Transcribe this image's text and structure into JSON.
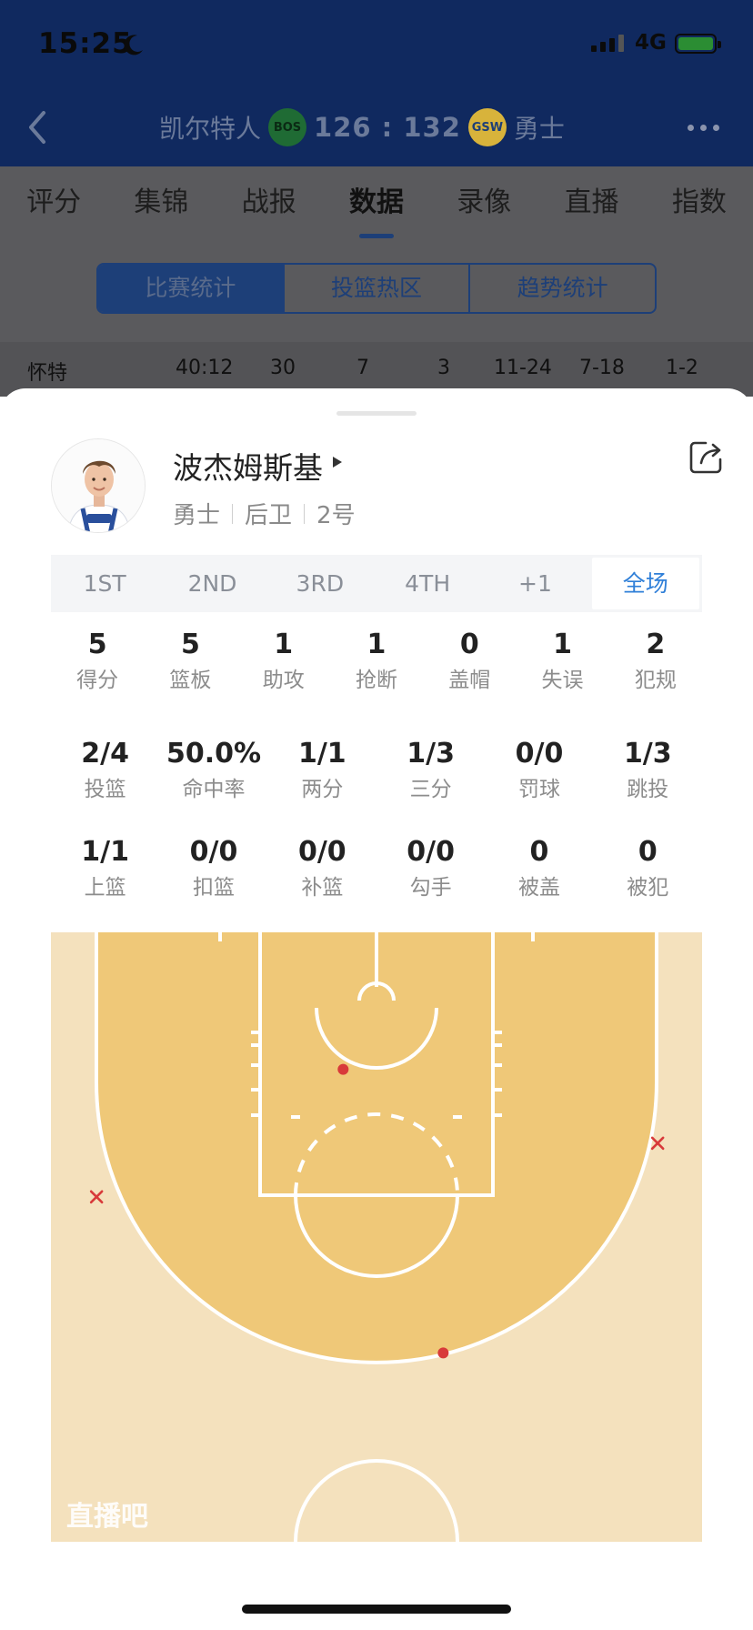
{
  "status_bar": {
    "time": "15:25",
    "network": "4G"
  },
  "header": {
    "home_team": "凯尔特人",
    "home_logo": "BOS",
    "score": "126 : 132",
    "away_logo": "GSW",
    "away_team": "勇士"
  },
  "tabs": [
    {
      "label": "评分"
    },
    {
      "label": "集锦"
    },
    {
      "label": "战报"
    },
    {
      "label": "数据",
      "active": true
    },
    {
      "label": "录像"
    },
    {
      "label": "直播"
    },
    {
      "label": "指数"
    }
  ],
  "segments": [
    {
      "label": "比赛统计",
      "active": true
    },
    {
      "label": "投篮热区"
    },
    {
      "label": "趋势统计"
    }
  ],
  "background_row": [
    "怀特",
    "40:12",
    "30",
    "7",
    "3",
    "11-24",
    "7-18",
    "1-2"
  ],
  "player": {
    "name": "波杰姆斯基",
    "team": "勇士",
    "position": "后卫",
    "number": "2号"
  },
  "quarter_tabs": [
    {
      "label": "1ST"
    },
    {
      "label": "2ND"
    },
    {
      "label": "3RD"
    },
    {
      "label": "4TH"
    },
    {
      "label": "+1"
    },
    {
      "label": "全场",
      "active": true
    }
  ],
  "stats_main": [
    {
      "value": "5",
      "label": "得分"
    },
    {
      "value": "5",
      "label": "篮板"
    },
    {
      "value": "1",
      "label": "助攻"
    },
    {
      "value": "1",
      "label": "抢断"
    },
    {
      "value": "0",
      "label": "盖帽"
    },
    {
      "value": "1",
      "label": "失误"
    },
    {
      "value": "2",
      "label": "犯规"
    }
  ],
  "stats_shooting": [
    {
      "value": "2/4",
      "label": "投篮"
    },
    {
      "value": "50.0%",
      "label": "命中率"
    },
    {
      "value": "1/1",
      "label": "两分"
    },
    {
      "value": "1/3",
      "label": "三分"
    },
    {
      "value": "0/0",
      "label": "罚球"
    },
    {
      "value": "1/3",
      "label": "跳投"
    }
  ],
  "stats_types": [
    {
      "value": "1/1",
      "label": "上篮"
    },
    {
      "value": "0/0",
      "label": "扣篮"
    },
    {
      "value": "0/0",
      "label": "补篮"
    },
    {
      "value": "0/0",
      "label": "勾手"
    },
    {
      "value": "0",
      "label": "被盖"
    },
    {
      "value": "0",
      "label": "被犯"
    }
  ],
  "shot_chart": {
    "watermark": "直播吧",
    "colors": {
      "made": "#d83a3a",
      "missed": "#d83a3a",
      "paint": "#efc878",
      "floor": "#f4e1bd"
    },
    "shots": [
      {
        "result": "made",
        "x_ft": -2.8,
        "y_ft": 7.3
      },
      {
        "result": "made",
        "x_ft": 5.6,
        "y_ft": 31.1
      },
      {
        "result": "missed",
        "x_ft": 23.6,
        "y_ft": 13.5
      },
      {
        "result": "missed",
        "x_ft": -23.5,
        "y_ft": 18.0
      }
    ]
  },
  "icons": {
    "back": "chevron-left-icon",
    "more": "more-dots-icon",
    "share": "share-icon",
    "moon": "moon-icon",
    "signal": "signal-icon",
    "battery": "battery-charging-icon"
  }
}
